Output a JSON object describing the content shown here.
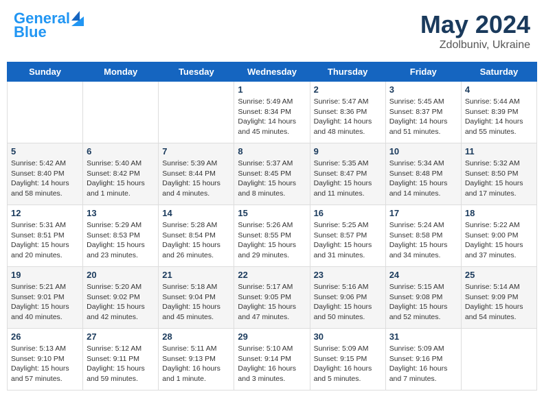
{
  "header": {
    "logo_line1": "General",
    "logo_line2": "Blue",
    "main_title": "May 2024",
    "subtitle": "Zdolbuniv, Ukraine"
  },
  "calendar": {
    "days_of_week": [
      "Sunday",
      "Monday",
      "Tuesday",
      "Wednesday",
      "Thursday",
      "Friday",
      "Saturday"
    ],
    "weeks": [
      [
        {
          "day": "",
          "info": ""
        },
        {
          "day": "",
          "info": ""
        },
        {
          "day": "",
          "info": ""
        },
        {
          "day": "1",
          "info": "Sunrise: 5:49 AM\nSunset: 8:34 PM\nDaylight: 14 hours\nand 45 minutes."
        },
        {
          "day": "2",
          "info": "Sunrise: 5:47 AM\nSunset: 8:36 PM\nDaylight: 14 hours\nand 48 minutes."
        },
        {
          "day": "3",
          "info": "Sunrise: 5:45 AM\nSunset: 8:37 PM\nDaylight: 14 hours\nand 51 minutes."
        },
        {
          "day": "4",
          "info": "Sunrise: 5:44 AM\nSunset: 8:39 PM\nDaylight: 14 hours\nand 55 minutes."
        }
      ],
      [
        {
          "day": "5",
          "info": "Sunrise: 5:42 AM\nSunset: 8:40 PM\nDaylight: 14 hours\nand 58 minutes."
        },
        {
          "day": "6",
          "info": "Sunrise: 5:40 AM\nSunset: 8:42 PM\nDaylight: 15 hours\nand 1 minute."
        },
        {
          "day": "7",
          "info": "Sunrise: 5:39 AM\nSunset: 8:44 PM\nDaylight: 15 hours\nand 4 minutes."
        },
        {
          "day": "8",
          "info": "Sunrise: 5:37 AM\nSunset: 8:45 PM\nDaylight: 15 hours\nand 8 minutes."
        },
        {
          "day": "9",
          "info": "Sunrise: 5:35 AM\nSunset: 8:47 PM\nDaylight: 15 hours\nand 11 minutes."
        },
        {
          "day": "10",
          "info": "Sunrise: 5:34 AM\nSunset: 8:48 PM\nDaylight: 15 hours\nand 14 minutes."
        },
        {
          "day": "11",
          "info": "Sunrise: 5:32 AM\nSunset: 8:50 PM\nDaylight: 15 hours\nand 17 minutes."
        }
      ],
      [
        {
          "day": "12",
          "info": "Sunrise: 5:31 AM\nSunset: 8:51 PM\nDaylight: 15 hours\nand 20 minutes."
        },
        {
          "day": "13",
          "info": "Sunrise: 5:29 AM\nSunset: 8:53 PM\nDaylight: 15 hours\nand 23 minutes."
        },
        {
          "day": "14",
          "info": "Sunrise: 5:28 AM\nSunset: 8:54 PM\nDaylight: 15 hours\nand 26 minutes."
        },
        {
          "day": "15",
          "info": "Sunrise: 5:26 AM\nSunset: 8:55 PM\nDaylight: 15 hours\nand 29 minutes."
        },
        {
          "day": "16",
          "info": "Sunrise: 5:25 AM\nSunset: 8:57 PM\nDaylight: 15 hours\nand 31 minutes."
        },
        {
          "day": "17",
          "info": "Sunrise: 5:24 AM\nSunset: 8:58 PM\nDaylight: 15 hours\nand 34 minutes."
        },
        {
          "day": "18",
          "info": "Sunrise: 5:22 AM\nSunset: 9:00 PM\nDaylight: 15 hours\nand 37 minutes."
        }
      ],
      [
        {
          "day": "19",
          "info": "Sunrise: 5:21 AM\nSunset: 9:01 PM\nDaylight: 15 hours\nand 40 minutes."
        },
        {
          "day": "20",
          "info": "Sunrise: 5:20 AM\nSunset: 9:02 PM\nDaylight: 15 hours\nand 42 minutes."
        },
        {
          "day": "21",
          "info": "Sunrise: 5:18 AM\nSunset: 9:04 PM\nDaylight: 15 hours\nand 45 minutes."
        },
        {
          "day": "22",
          "info": "Sunrise: 5:17 AM\nSunset: 9:05 PM\nDaylight: 15 hours\nand 47 minutes."
        },
        {
          "day": "23",
          "info": "Sunrise: 5:16 AM\nSunset: 9:06 PM\nDaylight: 15 hours\nand 50 minutes."
        },
        {
          "day": "24",
          "info": "Sunrise: 5:15 AM\nSunset: 9:08 PM\nDaylight: 15 hours\nand 52 minutes."
        },
        {
          "day": "25",
          "info": "Sunrise: 5:14 AM\nSunset: 9:09 PM\nDaylight: 15 hours\nand 54 minutes."
        }
      ],
      [
        {
          "day": "26",
          "info": "Sunrise: 5:13 AM\nSunset: 9:10 PM\nDaylight: 15 hours\nand 57 minutes."
        },
        {
          "day": "27",
          "info": "Sunrise: 5:12 AM\nSunset: 9:11 PM\nDaylight: 15 hours\nand 59 minutes."
        },
        {
          "day": "28",
          "info": "Sunrise: 5:11 AM\nSunset: 9:13 PM\nDaylight: 16 hours\nand 1 minute."
        },
        {
          "day": "29",
          "info": "Sunrise: 5:10 AM\nSunset: 9:14 PM\nDaylight: 16 hours\nand 3 minutes."
        },
        {
          "day": "30",
          "info": "Sunrise: 5:09 AM\nSunset: 9:15 PM\nDaylight: 16 hours\nand 5 minutes."
        },
        {
          "day": "31",
          "info": "Sunrise: 5:09 AM\nSunset: 9:16 PM\nDaylight: 16 hours\nand 7 minutes."
        },
        {
          "day": "",
          "info": ""
        }
      ]
    ]
  }
}
